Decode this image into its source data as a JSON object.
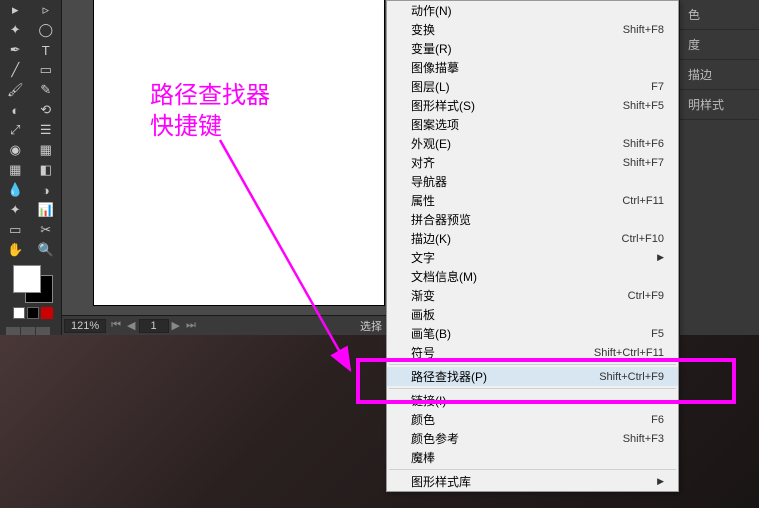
{
  "toolbar": {
    "tools": [
      [
        "▶",
        "✦"
      ],
      [
        "📋",
        "⬚"
      ],
      [
        "◐",
        "☰"
      ],
      [
        "🧪",
        "🔲"
      ],
      [
        "🔍",
        "📊"
      ],
      [
        "▭",
        "▦"
      ],
      [
        "✂",
        "✏"
      ],
      [
        "🖐",
        "🔍"
      ]
    ]
  },
  "status": {
    "zoom": "121%",
    "page": "1",
    "text": "选择"
  },
  "panels": [
    "色",
    "度",
    "描边",
    "明样式"
  ],
  "annotation": {
    "line1": "路径查找器",
    "line2": "快捷键"
  },
  "menu": {
    "items": [
      {
        "label": "动作(N)",
        "shortcut": "",
        "type": "item"
      },
      {
        "label": "变换",
        "shortcut": "Shift+F8",
        "type": "item"
      },
      {
        "label": "变量(R)",
        "shortcut": "",
        "type": "item"
      },
      {
        "label": "图像描摹",
        "shortcut": "",
        "type": "item"
      },
      {
        "label": "图层(L)",
        "shortcut": "F7",
        "type": "item"
      },
      {
        "label": "图形样式(S)",
        "shortcut": "Shift+F5",
        "type": "item"
      },
      {
        "label": "图案选项",
        "shortcut": "",
        "type": "item"
      },
      {
        "label": "外观(E)",
        "shortcut": "Shift+F6",
        "type": "item"
      },
      {
        "label": "对齐",
        "shortcut": "Shift+F7",
        "type": "item"
      },
      {
        "label": "导航器",
        "shortcut": "",
        "type": "item"
      },
      {
        "label": "属性",
        "shortcut": "Ctrl+F11",
        "type": "item"
      },
      {
        "label": "拼合器预览",
        "shortcut": "",
        "type": "item"
      },
      {
        "label": "描边(K)",
        "shortcut": "Ctrl+F10",
        "type": "item"
      },
      {
        "label": "文字",
        "shortcut": "",
        "type": "submenu"
      },
      {
        "label": "文档信息(M)",
        "shortcut": "",
        "type": "item"
      },
      {
        "label": "渐变",
        "shortcut": "Ctrl+F9",
        "type": "item"
      },
      {
        "label": "画板",
        "shortcut": "",
        "type": "item"
      },
      {
        "label": "画笔(B)",
        "shortcut": "F5",
        "type": "item"
      },
      {
        "label": "符号",
        "shortcut": "Shift+Ctrl+F11",
        "type": "item"
      },
      {
        "type": "sep"
      },
      {
        "label": "路径查找器(P)",
        "shortcut": "Shift+Ctrl+F9",
        "type": "item",
        "highlighted": true
      },
      {
        "type": "sep-partial"
      },
      {
        "label": "链接(I)",
        "shortcut": "",
        "type": "item"
      },
      {
        "label": "颜色",
        "shortcut": "F6",
        "type": "item"
      },
      {
        "label": "颜色参考",
        "shortcut": "Shift+F3",
        "type": "item"
      },
      {
        "label": "魔棒",
        "shortcut": "",
        "type": "item"
      },
      {
        "type": "sep"
      },
      {
        "label": "图形样式库",
        "shortcut": "",
        "type": "submenu"
      }
    ]
  }
}
